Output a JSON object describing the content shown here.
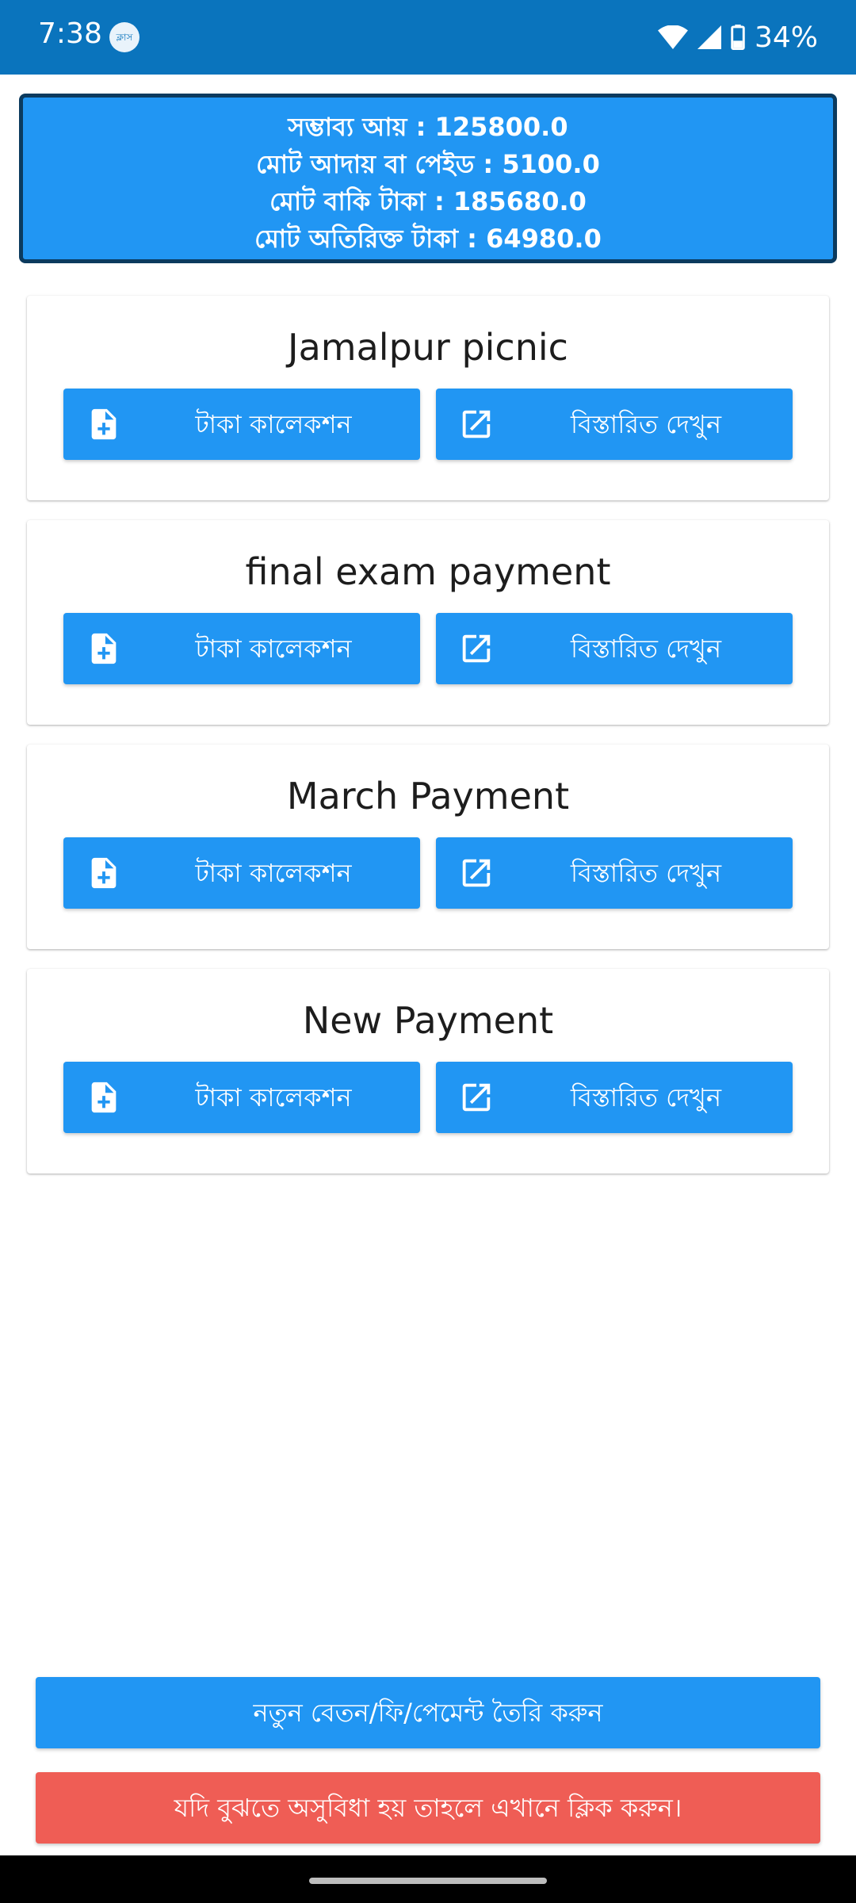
{
  "status_bar": {
    "time": "7:38",
    "app_icon_text": "ক্লাস",
    "battery": "34%"
  },
  "summary": {
    "line1": "সম্ভাব্য আয় : 125800.0",
    "line2": "মোট আদায় বা পেইড : 5100.0",
    "line3": "মোট বাকি টাকা : 185680.0",
    "line4": "মোট অতিরিক্ত টাকা : 64980.0"
  },
  "cards": [
    {
      "title": "Jamalpur picnic",
      "collect_label": "টাকা কালেকশন",
      "details_label": "বিস্তারিত দেখুন"
    },
    {
      "title": "final exam payment",
      "collect_label": "টাকা কালেকশন",
      "details_label": "বিস্তারিত দেখুন"
    },
    {
      "title": "March Payment",
      "collect_label": "টাকা কালেকশন",
      "details_label": "বিস্তারিত দেখুন"
    },
    {
      "title": "New Payment",
      "collect_label": "টাকা কালেকশন",
      "details_label": "বিস্তারিত দেখুন"
    }
  ],
  "actions": {
    "create_label": "নতুন বেতন/ফি/পেমেন্ট তৈরি করুন",
    "help_label": "যদি বুঝতে অসুবিধা হয় তাহলে এখানে ক্লিক করুন।"
  },
  "colors": {
    "status_bar": "#0a74bd",
    "primary": "#2196f3",
    "danger": "#ef5d55",
    "summary_border": "#0b3a5e"
  }
}
